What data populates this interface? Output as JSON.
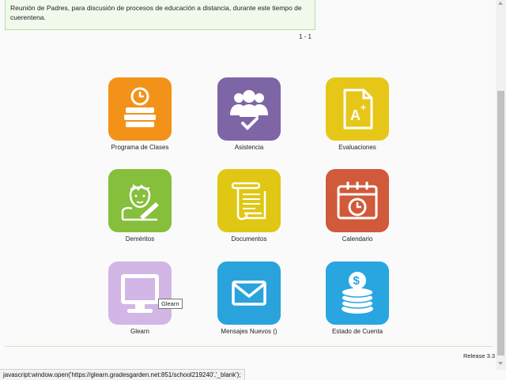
{
  "notice": {
    "text": "Reunión de Padres, para discusión de procesos de educación a distancia, durante este tiempo de cuerentena."
  },
  "pager": "1 - 1",
  "tiles": [
    {
      "label": "Programa de Clases",
      "icon": "schedule-books-icon",
      "color": "#f39219"
    },
    {
      "label": "Asistencia",
      "icon": "attendance-group-icon",
      "color": "#7e65a6"
    },
    {
      "label": "Evaluaciones",
      "icon": "grade-document-icon",
      "color": "#e6c718"
    },
    {
      "label": "Deméritos",
      "icon": "student-writing-icon",
      "color": "#86bf3b"
    },
    {
      "label": "Documentos",
      "icon": "scroll-document-icon",
      "color": "#e0c713"
    },
    {
      "label": "Calendario",
      "icon": "calendar-clock-icon",
      "color": "#d05a3a"
    },
    {
      "label": "Glearn",
      "icon": "monitor-icon",
      "color": "#d2b6e6"
    },
    {
      "label": "Mensajes Nuevos ()",
      "icon": "envelope-icon",
      "color": "#2aa3dc"
    },
    {
      "label": "Estado de Cuenta",
      "icon": "coin-stack-icon",
      "color": "#29a6e0"
    }
  ],
  "tooltip": "Glearn",
  "release": "Release 3.3",
  "statusbar": "javascript:window.open('https://glearn.gradesgarden.net:851/school219240','_blank');"
}
